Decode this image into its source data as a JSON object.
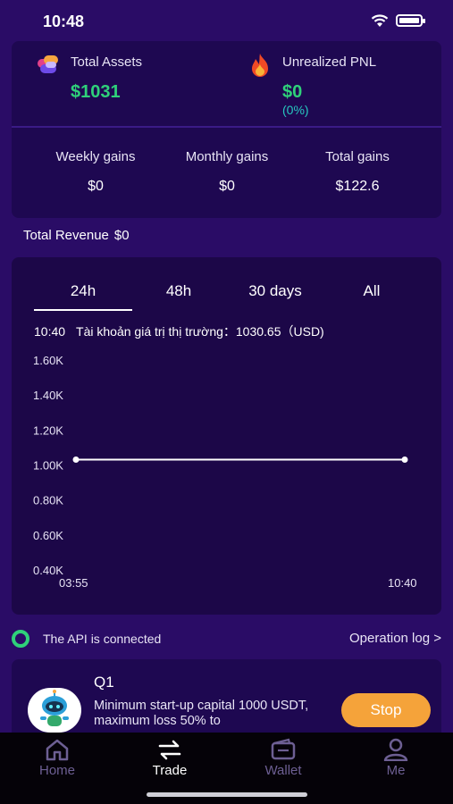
{
  "status": {
    "time": "10:48"
  },
  "summary": {
    "total_assets_label": "Total Assets",
    "total_assets_value": "$1031",
    "pnl_label": "Unrealized PNL",
    "pnl_value": "$0",
    "pnl_percent": "(0%)"
  },
  "gains": [
    {
      "label": "Weekly gains",
      "value": "$0"
    },
    {
      "label": "Monthly gains",
      "value": "$0"
    },
    {
      "label": "Total gains",
      "value": "$122.6"
    }
  ],
  "revenue": {
    "label": "Total Revenue",
    "value": "$0"
  },
  "chart_tabs": [
    "24h",
    "48h",
    "30 days",
    "All"
  ],
  "active_tab": "24h",
  "market_line": {
    "time": "10:40",
    "text": "Tài khoản giá trị thị trường：1030.65（USD)"
  },
  "chart_data": {
    "type": "line",
    "x": [
      "03:55",
      "10:40"
    ],
    "series": [
      {
        "values": [
          1030.65,
          1030.65
        ]
      }
    ],
    "y_tick_labels": [
      "1.60K",
      "1.40K",
      "1.20K",
      "1.00K",
      "0.80K",
      "0.60K",
      "0.40K"
    ],
    "x_tick_labels": [
      "03:55",
      "10:40"
    ],
    "ylim": [
      400,
      1600
    ],
    "grid": false,
    "line_color": "#ffffff"
  },
  "api": {
    "status_text": "The API is connected",
    "oplog_label": "Operation log >"
  },
  "strategy": {
    "name": "Q1",
    "description": "Minimum start-up capital 1000 USDT, maximum loss 50% to",
    "stop_label": "Stop"
  },
  "tabbar": [
    {
      "label": "Home",
      "icon": "home-icon"
    },
    {
      "label": "Trade",
      "icon": "swap-icon"
    },
    {
      "label": "Wallet",
      "icon": "wallet-icon"
    },
    {
      "label": "Me",
      "icon": "person-icon"
    }
  ],
  "active_nav": "Trade",
  "colors": {
    "background": "#2a0c66",
    "card": "#1e0851",
    "green": "#2fd17a",
    "teal": "#27c8c0",
    "orange": "#f5a33a"
  }
}
